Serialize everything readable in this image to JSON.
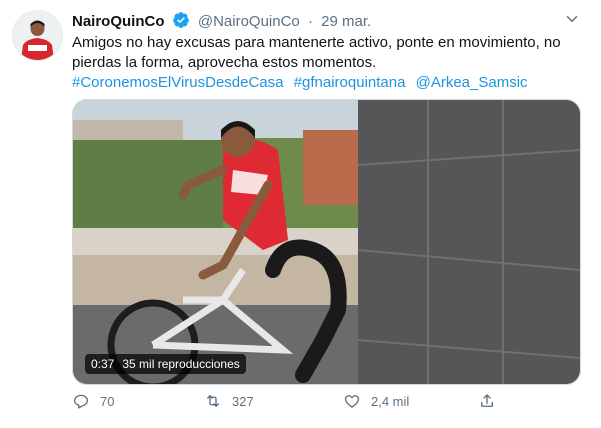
{
  "tweet": {
    "author_name": "NairoQuinCo",
    "handle": "@NairoQuinCo",
    "separator": "·",
    "date": "29 mar.",
    "text_lines": [
      "Amigos no hay excusas para mantenerte activo, ponte en movimiento, no",
      "pierdas la forma,  aprovecha estos momentos."
    ],
    "tags": [
      "#CoronemosElVirusDesdeCasa",
      "#gfnairoquintana",
      "@Arkea_Samsic"
    ],
    "video": {
      "duration": "0:37",
      "views": "35 mil reproducciones"
    },
    "actions": {
      "replies": "70",
      "retweets": "327",
      "likes": "2,4 mil"
    }
  },
  "colors": {
    "link": "#1b95e0",
    "muted": "#5b7083",
    "verified": "#1da1f2"
  },
  "icons": [
    "verified-badge-icon",
    "caret-down-icon",
    "reply-icon",
    "retweet-icon",
    "like-icon",
    "share-icon"
  ]
}
